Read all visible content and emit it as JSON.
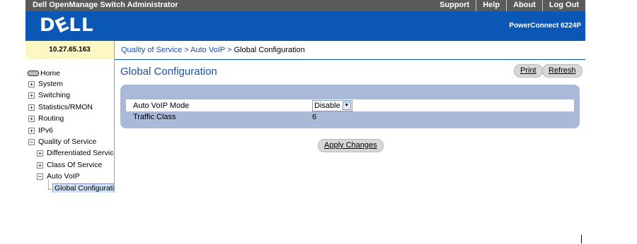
{
  "header": {
    "app_title": "Dell OpenManage Switch Administrator",
    "links": [
      "Support",
      "Help",
      "About",
      "Log Out"
    ],
    "logo": "DELL",
    "model": "PowerConnect 6224P"
  },
  "ip_address": "10.27.65.163",
  "breadcrumb": {
    "items": [
      "Quality of Service",
      "Auto VoIP",
      "Global Configuration"
    ],
    "separator": ">"
  },
  "sidebar": {
    "home": "Home",
    "items": [
      {
        "label": "System",
        "expander": "+"
      },
      {
        "label": "Switching",
        "expander": "+"
      },
      {
        "label": "Statistics/RMON",
        "expander": "+"
      },
      {
        "label": "Routing",
        "expander": "+"
      },
      {
        "label": "IPv6",
        "expander": "+"
      },
      {
        "label": "Quality of Service",
        "expander": "−"
      },
      {
        "label": "Differentiated Services",
        "expander": "+"
      },
      {
        "label": "Class Of Service",
        "expander": "+"
      },
      {
        "label": "Auto VoIP",
        "expander": "−"
      },
      {
        "label": "Global Configuration",
        "expander": ""
      }
    ]
  },
  "main": {
    "page_title": "Global Configuration",
    "print_label": "Print",
    "refresh_label": "Refresh",
    "rows": [
      {
        "label": "Auto VoIP Mode",
        "value": "Disable"
      },
      {
        "label": "Traffic Class",
        "value": "6"
      }
    ],
    "apply_label": "Apply Changes"
  },
  "colors": {
    "banner": "#0a57b5",
    "title_bar": "#5a5a5a",
    "panel": "#aab9d8",
    "link": "#1a4fa8",
    "ip_cell": "#fdf7c3"
  }
}
